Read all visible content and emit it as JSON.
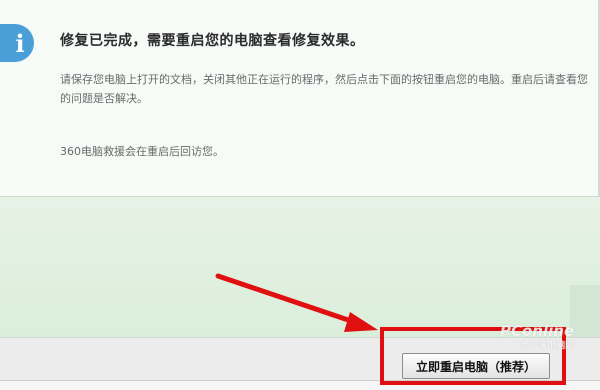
{
  "dialog": {
    "title": "修复已完成，需要重启您的电脑查看修复效果。",
    "description": "请保存您电脑上打开的文档，关闭其他正在运行的程序，然后点击下面的按钮重启您的电脑。重启后请查看您的问题是否解决。",
    "note": "360电脑救援会在重启后回访您。",
    "info_icon_glyph": "i"
  },
  "actions": {
    "restart_label": "立即重启电脑（推荐）"
  },
  "watermark": {
    "brand": "PConline",
    "sub": "太平洋电脑网"
  },
  "colors": {
    "info_icon": "#4a9fd8",
    "highlight": "#e01010",
    "panel_bg": "#f7fbf7",
    "area_bg": "#e3f0e3"
  }
}
